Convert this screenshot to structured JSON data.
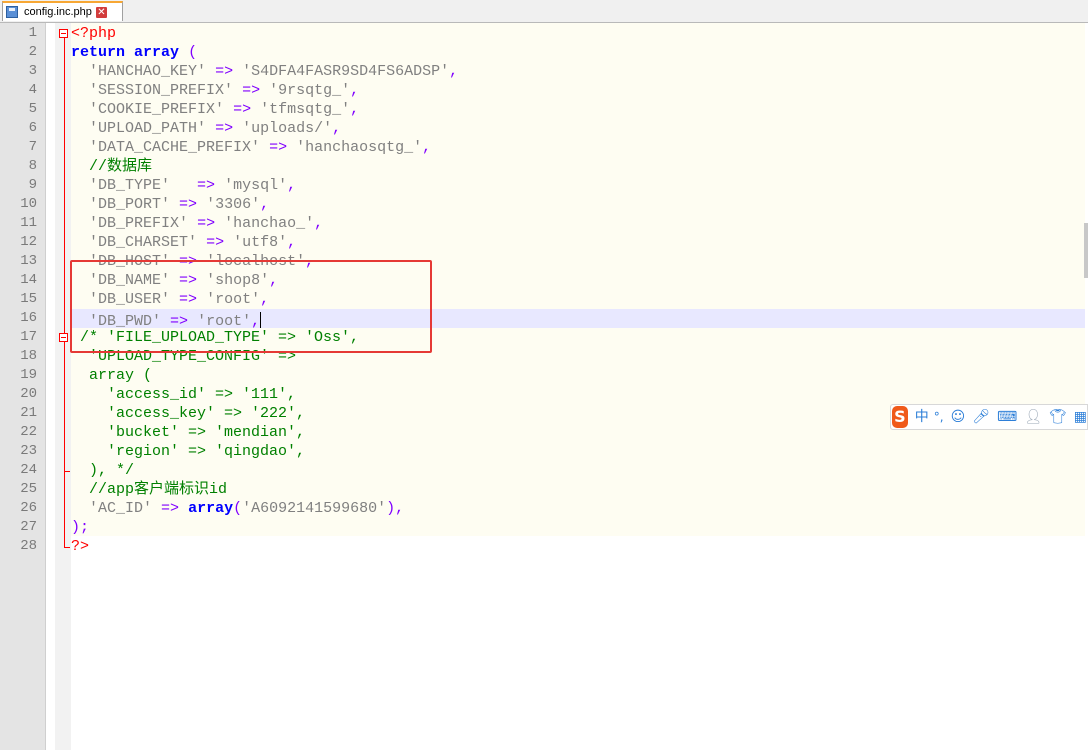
{
  "tab": {
    "label": "config.inc.php",
    "close_glyph": "✕",
    "icon": "save-icon"
  },
  "line_numbers": [
    "1",
    "2",
    "3",
    "4",
    "5",
    "6",
    "7",
    "8",
    "9",
    "10",
    "11",
    "12",
    "13",
    "14",
    "15",
    "16",
    "17",
    "18",
    "19",
    "20",
    "21",
    "22",
    "23",
    "24",
    "25",
    "26",
    "27",
    "28"
  ],
  "code": [
    [
      [
        "tag",
        "<?php"
      ]
    ],
    [
      [
        "kw",
        "return"
      ],
      [
        "plain",
        " "
      ],
      [
        "kw",
        "array"
      ],
      [
        "plain",
        " "
      ],
      [
        "op",
        "("
      ]
    ],
    [
      [
        "plain",
        "  "
      ],
      [
        "str",
        "'HANCHAO_KEY'"
      ],
      [
        "plain",
        " "
      ],
      [
        "op",
        "=>"
      ],
      [
        "plain",
        " "
      ],
      [
        "str",
        "'S4DFA4FASR9SD4FS6ADSP'"
      ],
      [
        "op",
        ","
      ]
    ],
    [
      [
        "plain",
        "  "
      ],
      [
        "str",
        "'SESSION_PREFIX'"
      ],
      [
        "plain",
        " "
      ],
      [
        "op",
        "=>"
      ],
      [
        "plain",
        " "
      ],
      [
        "str",
        "'9rsqtg_'"
      ],
      [
        "op",
        ","
      ]
    ],
    [
      [
        "plain",
        "  "
      ],
      [
        "str",
        "'COOKIE_PREFIX'"
      ],
      [
        "plain",
        " "
      ],
      [
        "op",
        "=>"
      ],
      [
        "plain",
        " "
      ],
      [
        "str",
        "'tfmsqtg_'"
      ],
      [
        "op",
        ","
      ]
    ],
    [
      [
        "plain",
        "  "
      ],
      [
        "str",
        "'UPLOAD_PATH'"
      ],
      [
        "plain",
        " "
      ],
      [
        "op",
        "=>"
      ],
      [
        "plain",
        " "
      ],
      [
        "str",
        "'uploads/'"
      ],
      [
        "op",
        ","
      ]
    ],
    [
      [
        "plain",
        "  "
      ],
      [
        "str",
        "'DATA_CACHE_PREFIX'"
      ],
      [
        "plain",
        " "
      ],
      [
        "op",
        "=>"
      ],
      [
        "plain",
        " "
      ],
      [
        "str",
        "'hanchaosqtg_'"
      ],
      [
        "op",
        ","
      ]
    ],
    [
      [
        "plain",
        "  "
      ],
      [
        "cm",
        "//数据库"
      ]
    ],
    [
      [
        "plain",
        "  "
      ],
      [
        "str",
        "'DB_TYPE'"
      ],
      [
        "plain",
        "   "
      ],
      [
        "op",
        "=>"
      ],
      [
        "plain",
        " "
      ],
      [
        "str",
        "'mysql'"
      ],
      [
        "op",
        ","
      ]
    ],
    [
      [
        "plain",
        "  "
      ],
      [
        "str",
        "'DB_PORT'"
      ],
      [
        "plain",
        " "
      ],
      [
        "op",
        "=>"
      ],
      [
        "plain",
        " "
      ],
      [
        "str",
        "'3306'"
      ],
      [
        "op",
        ","
      ]
    ],
    [
      [
        "plain",
        "  "
      ],
      [
        "str",
        "'DB_PREFIX'"
      ],
      [
        "plain",
        " "
      ],
      [
        "op",
        "=>"
      ],
      [
        "plain",
        " "
      ],
      [
        "str",
        "'hanchao_'"
      ],
      [
        "op",
        ","
      ]
    ],
    [
      [
        "plain",
        "  "
      ],
      [
        "str",
        "'DB_CHARSET'"
      ],
      [
        "plain",
        " "
      ],
      [
        "op",
        "=>"
      ],
      [
        "plain",
        " "
      ],
      [
        "str",
        "'utf8'"
      ],
      [
        "op",
        ","
      ]
    ],
    [
      [
        "plain",
        "  "
      ],
      [
        "str",
        "'DB_HOST'"
      ],
      [
        "plain",
        " "
      ],
      [
        "op",
        "=>"
      ],
      [
        "plain",
        " "
      ],
      [
        "str",
        "'localhost'"
      ],
      [
        "op",
        ","
      ]
    ],
    [
      [
        "plain",
        "  "
      ],
      [
        "str",
        "'DB_NAME'"
      ],
      [
        "plain",
        " "
      ],
      [
        "op",
        "=>"
      ],
      [
        "plain",
        " "
      ],
      [
        "str",
        "'shop8'"
      ],
      [
        "op",
        ","
      ]
    ],
    [
      [
        "plain",
        "  "
      ],
      [
        "str",
        "'DB_USER'"
      ],
      [
        "plain",
        " "
      ],
      [
        "op",
        "=>"
      ],
      [
        "plain",
        " "
      ],
      [
        "str",
        "'root'"
      ],
      [
        "op",
        ","
      ]
    ],
    [
      [
        "plain",
        "  "
      ],
      [
        "str",
        "'DB_PWD'"
      ],
      [
        "plain",
        " "
      ],
      [
        "op",
        "=>"
      ],
      [
        "plain",
        " "
      ],
      [
        "str",
        "'root'"
      ],
      [
        "op",
        ","
      ]
    ],
    [
      [
        "plain",
        " "
      ],
      [
        "cm",
        "/* 'FILE_UPLOAD_TYPE' => 'Oss',"
      ]
    ],
    [
      [
        "plain",
        "  "
      ],
      [
        "cm",
        "'UPLOAD_TYPE_CONFIG' =>"
      ]
    ],
    [
      [
        "plain",
        "  "
      ],
      [
        "cm",
        "array ("
      ]
    ],
    [
      [
        "plain",
        "    "
      ],
      [
        "cm",
        "'access_id' => '111',"
      ]
    ],
    [
      [
        "plain",
        "    "
      ],
      [
        "cm",
        "'access_key' => '222',"
      ]
    ],
    [
      [
        "plain",
        "    "
      ],
      [
        "cm",
        "'bucket' => 'mendian',"
      ]
    ],
    [
      [
        "plain",
        "    "
      ],
      [
        "cm",
        "'region' => 'qingdao',"
      ]
    ],
    [
      [
        "plain",
        "  "
      ],
      [
        "cm",
        "), */"
      ]
    ],
    [
      [
        "plain",
        "  "
      ],
      [
        "cm",
        "//app客户端标识id"
      ]
    ],
    [
      [
        "plain",
        "  "
      ],
      [
        "str",
        "'AC_ID'"
      ],
      [
        "plain",
        " "
      ],
      [
        "op",
        "=>"
      ],
      [
        "plain",
        " "
      ],
      [
        "kw",
        "array"
      ],
      [
        "op",
        "("
      ],
      [
        "str",
        "'A6092141599680'"
      ],
      [
        "op",
        "),"
      ]
    ],
    [
      [
        "op",
        ");"
      ]
    ],
    [
      [
        "tag",
        "?>"
      ]
    ]
  ],
  "ime": {
    "lang": "中",
    "punct": "°,",
    "items": [
      "emoji-icon",
      "mic-icon",
      "keyboard-icon",
      "user-icon",
      "skin-icon",
      "grid-icon"
    ]
  }
}
